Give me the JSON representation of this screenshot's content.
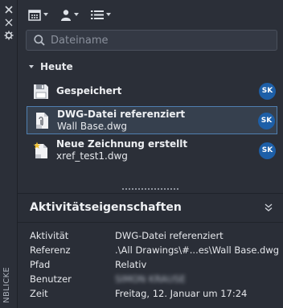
{
  "side_panel": {
    "vertical_label": "NBLICKE"
  },
  "toolbar": {
    "buttons": [
      {
        "icon": "calendar-icon"
      },
      {
        "icon": "user-icon"
      },
      {
        "icon": "list-icon"
      }
    ]
  },
  "search": {
    "placeholder": "Dateiname",
    "value": ""
  },
  "group": {
    "label": "Heute"
  },
  "activities": [
    {
      "icon": "floppy-disk-icon",
      "title": "Gespeichert",
      "subtitle": "",
      "user": "SK",
      "selected": false
    },
    {
      "icon": "dwg-reference-icon",
      "title": "DWG-Datei referenziert",
      "subtitle": "Wall Base.dwg",
      "user": "SK",
      "selected": true
    },
    {
      "icon": "new-drawing-icon",
      "title": "Neue Zeichnung erstellt",
      "subtitle": "xref_test1.dwg",
      "user": "SK",
      "selected": false
    }
  ],
  "properties": {
    "title": "Aktivitätseigenschaften",
    "rows": [
      {
        "key": "Aktivität",
        "value": "DWG-Datei referenziert"
      },
      {
        "key": "Referenz",
        "value": ".\\All Drawings\\#...es\\Wall Base.dwg"
      },
      {
        "key": "Pfad",
        "value": "Relativ"
      },
      {
        "key": "Benutzer",
        "value": "SIMON KRAUSE"
      },
      {
        "key": "Zeit",
        "value": "Freitag, 12. Januar um 17:24"
      }
    ]
  },
  "colors": {
    "background": "#2b2f38",
    "selection_border": "#4f7fb0",
    "selection_fill": "#36404e",
    "avatar": "#1d5fa8"
  }
}
